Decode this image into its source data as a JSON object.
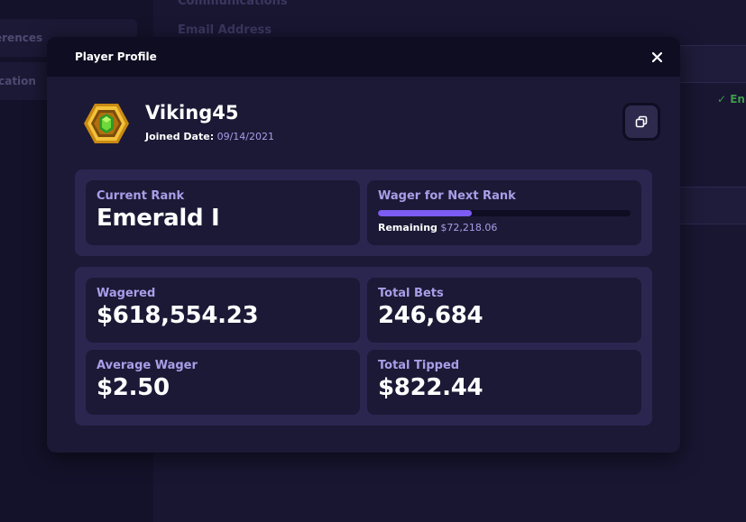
{
  "background": {
    "sidebar_items": [
      "erences",
      "ication"
    ],
    "section_heading": "Communications",
    "field_label": "Email Address",
    "verified_text": "✓ En"
  },
  "modal": {
    "title": "Player Profile",
    "close_symbol": "✕",
    "user": {
      "username": "Viking45",
      "joined_label": "Joined Date:",
      "joined_value": "09/14/2021"
    },
    "rank": {
      "current_rank_label": "Current Rank",
      "current_rank_value": "Emerald I",
      "next_rank_label": "Wager for Next Rank",
      "progress_fraction": 0.37,
      "remaining_label": "Remaining",
      "remaining_value": "$72,218.06"
    },
    "stats": [
      {
        "label": "Wagered",
        "value": "$618,554.23"
      },
      {
        "label": "Total Bets",
        "value": "246,684"
      },
      {
        "label": "Average Wager",
        "value": "$2.50"
      },
      {
        "label": "Total Tipped",
        "value": "$822.44"
      }
    ]
  },
  "colors": {
    "accent": "#7c5cf2",
    "label": "#a89ee8",
    "panel": "#2a2650",
    "card": "#1b1935",
    "verified": "#3f9a4c"
  },
  "icons": {
    "rank_badge": "emerald-hexagon-badge-icon",
    "copy": "copy-icon",
    "close": "close-icon"
  }
}
